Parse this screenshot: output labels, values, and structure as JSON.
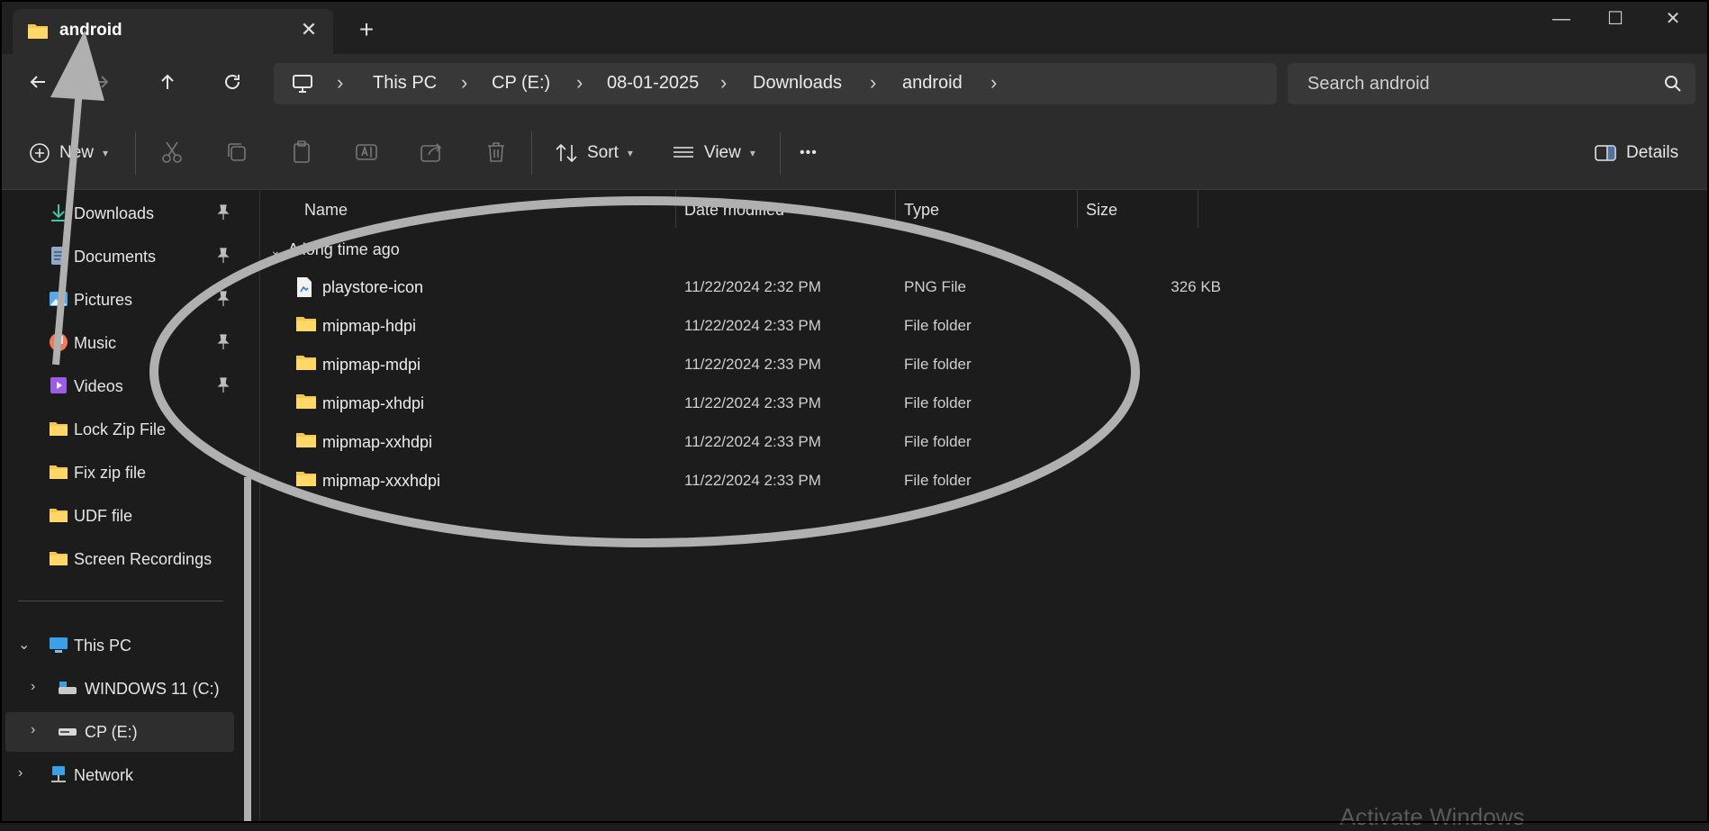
{
  "window": {
    "tab_title": "android",
    "new_tab_symbol": "+",
    "tab_close_symbol": "✕",
    "minimize_symbol": "—",
    "maximize_symbol": "☐",
    "close_symbol": "✕"
  },
  "nav": {
    "back_icon": "arrow-left-icon",
    "forward_icon": "arrow-right-icon",
    "up_icon": "arrow-up-icon",
    "refresh_icon": "refresh-icon"
  },
  "breadcrumb": [
    "This PC",
    "CP (E:)",
    "08-01-2025",
    "Downloads",
    "android"
  ],
  "search": {
    "placeholder": "Search android"
  },
  "toolbar": {
    "new_label": "New",
    "sort_label": "Sort",
    "view_label": "View",
    "more_label": "•••",
    "details_label": "Details"
  },
  "sidebar": {
    "quick_access": [
      {
        "label": "Downloads",
        "icon": "download-icon",
        "pinned": true
      },
      {
        "label": "Documents",
        "icon": "documents-icon",
        "pinned": true
      },
      {
        "label": "Pictures",
        "icon": "pictures-icon",
        "pinned": true
      },
      {
        "label": "Music",
        "icon": "music-icon",
        "pinned": true
      },
      {
        "label": "Videos",
        "icon": "videos-icon",
        "pinned": true
      },
      {
        "label": "Lock Zip File",
        "icon": "folder-icon",
        "pinned": false
      },
      {
        "label": "Fix zip file",
        "icon": "folder-icon",
        "pinned": false
      },
      {
        "label": "UDF file",
        "icon": "folder-icon",
        "pinned": false
      },
      {
        "label": "Screen Recordings",
        "icon": "folder-icon",
        "pinned": false
      }
    ],
    "this_pc_label": "This PC",
    "drives": [
      {
        "label": "WINDOWS 11 (C:)",
        "icon": "drive-c-icon"
      },
      {
        "label": "CP (E:)",
        "icon": "drive-e-icon",
        "selected": true
      }
    ],
    "network_label": "Network"
  },
  "file_list": {
    "columns": {
      "name": "Name",
      "date": "Date modified",
      "type": "Type",
      "size": "Size"
    },
    "group_label": "A long time ago",
    "rows": [
      {
        "name": "playstore-icon",
        "date": "11/22/2024 2:32 PM",
        "type": "PNG File",
        "size": "326 KB",
        "icon": "png-file-icon"
      },
      {
        "name": "mipmap-hdpi",
        "date": "11/22/2024 2:33 PM",
        "type": "File folder",
        "size": "",
        "icon": "folder-icon"
      },
      {
        "name": "mipmap-mdpi",
        "date": "11/22/2024 2:33 PM",
        "type": "File folder",
        "size": "",
        "icon": "folder-icon"
      },
      {
        "name": "mipmap-xhdpi",
        "date": "11/22/2024 2:33 PM",
        "type": "File folder",
        "size": "",
        "icon": "folder-icon"
      },
      {
        "name": "mipmap-xxhdpi",
        "date": "11/22/2024 2:33 PM",
        "type": "File folder",
        "size": "",
        "icon": "folder-icon"
      },
      {
        "name": "mipmap-xxxhdpi",
        "date": "11/22/2024 2:33 PM",
        "type": "File folder",
        "size": "",
        "icon": "folder-icon"
      }
    ]
  },
  "watermark": "Activate Windows",
  "colors": {
    "folder": "#f5c84c",
    "background": "#1c1c1c",
    "toolbar": "#2c2c2c",
    "annotation": "#b0b0b0"
  }
}
